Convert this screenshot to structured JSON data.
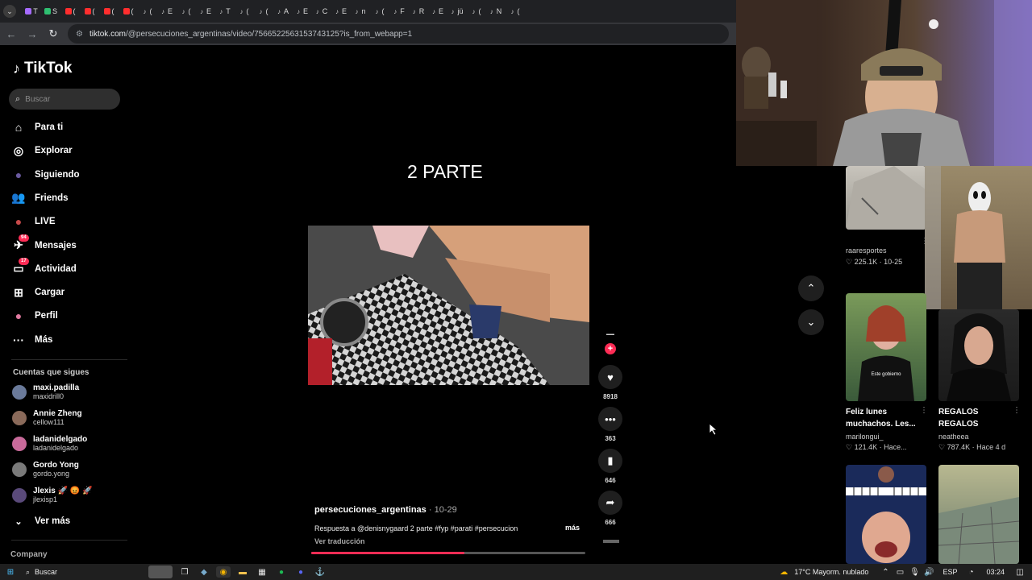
{
  "browser": {
    "tab_letters": [
      "T",
      "S",
      "(",
      "(",
      "(",
      "(",
      "(",
      "E",
      "(",
      "E",
      "T",
      "(",
      "(",
      "A",
      "E",
      "C",
      "E",
      "n",
      "(",
      "F",
      "R",
      "E",
      "jü",
      "(",
      "N",
      "("
    ],
    "url_host": "tiktok.com",
    "url_path": "/@persecuciones_argentinas/video/7566522563153743125?is_from_webapp=1"
  },
  "sidebar": {
    "brand": "TikTok",
    "search_placeholder": "Buscar",
    "nav": [
      {
        "label": "Para ti",
        "icon": "home-icon"
      },
      {
        "label": "Explorar",
        "icon": "compass-icon"
      },
      {
        "label": "Siguiendo",
        "icon": "following-avatar-icon"
      },
      {
        "label": "Friends",
        "icon": "friends-icon"
      },
      {
        "label": "LIVE",
        "icon": "live-icon"
      },
      {
        "label": "Mensajes",
        "icon": "messages-icon",
        "badge": "94"
      },
      {
        "label": "Actividad",
        "icon": "activity-icon",
        "badge": "17"
      },
      {
        "label": "Cargar",
        "icon": "upload-icon"
      },
      {
        "label": "Perfil",
        "icon": "profile-icon"
      },
      {
        "label": "Más",
        "icon": "more-icon"
      }
    ],
    "following_title": "Cuentas que sigues",
    "accounts": [
      {
        "name": "maxi.padilla",
        "handle": "maxidrill0",
        "color": "#6a7a9a"
      },
      {
        "name": "Annie Zheng",
        "handle": "cellow111",
        "color": "#8a6a5a"
      },
      {
        "name": "ladanidelgado",
        "handle": "ladanidelgado",
        "color": "#c86a9a"
      },
      {
        "name": "Gordo Yong",
        "handle": "gordo.yong",
        "color": "#7a7a7a"
      },
      {
        "name": "Jlexis 🚀 😡 🚀",
        "handle": "jlexisp1",
        "color": "#5a4a7a"
      }
    ],
    "see_more": "Ver más",
    "company": "Company"
  },
  "video": {
    "title": "2 PARTE",
    "likes": "8918",
    "comments": "363",
    "saves": "646",
    "shares": "666",
    "author": "persecuciones_argentinas",
    "date": "10-29",
    "description": "Respuesta a @denisnygaard 2 parte #fyp #parati #persecucion",
    "more": "más",
    "translate": "Ver traducción",
    "progress": 0.56
  },
  "right_column": {
    "items": [
      {
        "user": "raaresportes",
        "meta": "♡ 225.1K · 10-25"
      },
      {
        "title": "Feliz lunes muchachos. Les...",
        "user": "marilongui_",
        "meta": "♡ 121.4K · Hace..."
      },
      {
        "title": "REGALOS REGALOS",
        "user": "neatheea",
        "meta": "♡ 787.4K · Hace 4 d"
      }
    ],
    "caption_este": "Este gobierno"
  },
  "taskbar": {
    "search": "Buscar",
    "weather": "17°C  Mayorm. nublado",
    "lang": "ESP",
    "time": "03:24"
  },
  "colors": {
    "accent": "#fe2c55",
    "bg": "#000000"
  }
}
